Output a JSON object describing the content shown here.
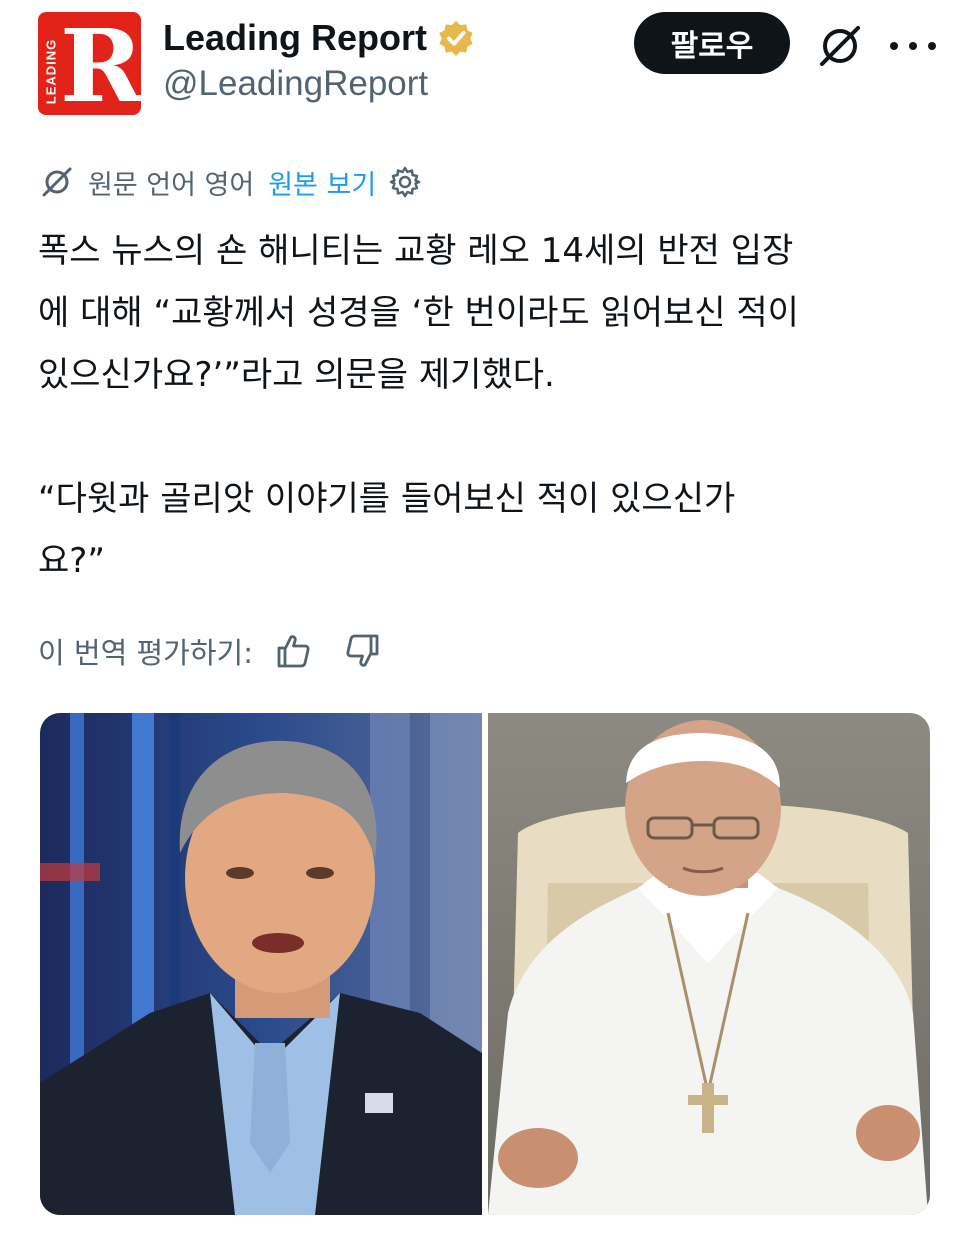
{
  "author": {
    "avatar_letter": "R",
    "avatar_vertical_text": "LEADING",
    "display_name": "Leading Report",
    "handle": "@LeadingReport",
    "verified": true,
    "verified_badge_color": "#f4b400",
    "avatar_color": "#e2231a"
  },
  "actions": {
    "follow_label": "팔로우",
    "grok_icon": "grok-icon",
    "more_icon": "more-icon"
  },
  "translation": {
    "original_language_label": "원문 언어 영어",
    "view_original_label": "원본 보기",
    "link_color": "#1d9bf0"
  },
  "post": {
    "paragraph1": "폭스 뉴스의 숀 해니티는 교황 레오 14세의 반전 입장\n에 대해 “교황께서 성경을 ‘한 번이라도 읽어보신 적이\n있으신가요?’”라고 의문을 제기했다.",
    "paragraph2": "“다윗과 골리앗 이야기를 들어보신 적이 있으신가\n요?”"
  },
  "rating": {
    "label": "이 번역 평가하기:"
  },
  "media": {
    "images": [
      {
        "name": "sean-hannity-photo"
      },
      {
        "name": "pope-photo"
      }
    ]
  }
}
